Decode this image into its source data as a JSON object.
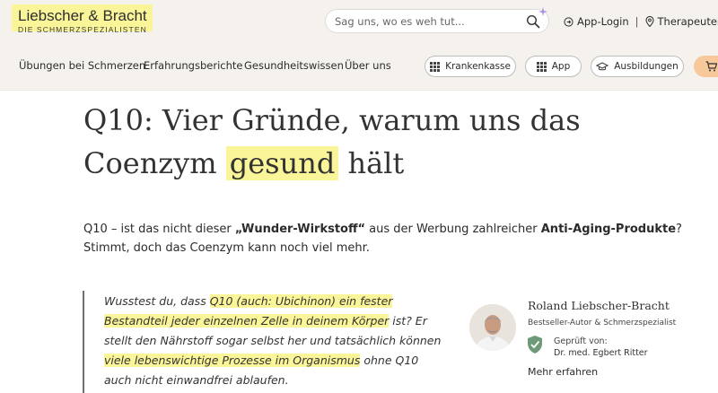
{
  "header": {
    "logo_name": "Liebscher & Bracht",
    "logo_tagline": "DIE SCHMERZSPEZIALISTEN",
    "search_placeholder": "Sag uns, wo es weh tut...",
    "app_login": "App-Login",
    "therapists": "Therapeuten fin"
  },
  "nav": {
    "items": [
      "Übungen bei Schmerzen",
      "Erfahrungsberichte",
      "Gesundheitswissen",
      "Über uns"
    ],
    "pills": [
      "Krankenkasse",
      "App",
      "Ausbildungen"
    ]
  },
  "article": {
    "title_line1": "Q10: Vier Gründe, warum uns das",
    "title_before": "Coenzym",
    "title_highlight": "gesund",
    "title_after": "hält",
    "lead_part1": "Q10 – ist das nicht dieser ",
    "lead_bold1": "„Wunder-Wirkstoff“",
    "lead_part2": " aus der Werbung zahlreicher ",
    "lead_bold2": "Anti-Aging-Produkte",
    "lead_part3": "? Stimmt, doch das Coenzym kann noch viel mehr.",
    "quote_part1": "Wusstest du, dass ",
    "quote_hl1": "Q10 (auch: Ubichinon) ein fester Bestandteil jeder einzelnen Zelle in deinem Körper",
    "quote_part2": " ist? Er stellt den Nährstoff sogar selbst her und tatsächlich können ",
    "quote_hl2": "viele lebenswichtige Prozesse im Organismus",
    "quote_part3": " ohne Q10 auch nicht einwandfrei ablaufen."
  },
  "author": {
    "name": "Roland Liebscher-Bracht",
    "role": "Bestseller-Autor & Schmerzspezialist",
    "checked_label": "Geprüft von:",
    "checked_by": "Dr. med. Egbert Ritter",
    "more": "Mehr erfahren"
  },
  "colors": {
    "highlight": "#fbf59a",
    "header_bg": "#f5f2ee",
    "cart_accent": "#f7c89a",
    "shield": "#6f9a78"
  }
}
